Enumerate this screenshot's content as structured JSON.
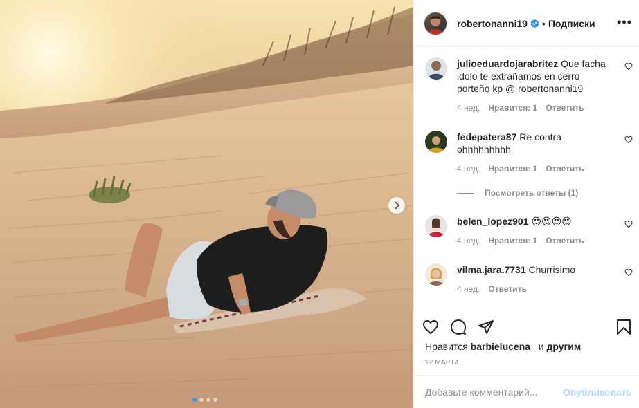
{
  "header": {
    "username": "robertonanni19",
    "bullet": "•",
    "follow_label": "Подписки",
    "more_label": "•••"
  },
  "comments": [
    {
      "username": "julioeduardojarabritez",
      "text": "Que facha idolo te extrañamos en cerro porteño kp @ robertonanni19",
      "time": "4 нед.",
      "likes": "Нравится: 1",
      "reply": "Ответить"
    },
    {
      "username": "fedepatera87",
      "text": "Re contra ohhhhhhhhh",
      "time": "4 нед.",
      "likes": "Нравится: 1",
      "reply": "Ответить"
    },
    {
      "username": "belen_lopez901",
      "text": "😍😍😍😍",
      "time": "4 нед.",
      "likes": "Нравится: 1",
      "reply": "Ответить"
    },
    {
      "username": "vilma.jara.7731",
      "text": "Churrisimo",
      "time": "4 нед.",
      "reply": "Ответить"
    }
  ],
  "view_replies": "Посмотреть ответы (1)",
  "likes_line": {
    "prefix": "Нравится",
    "user": "barbielucena_",
    "middle": "и",
    "suffix": "другим"
  },
  "date": "12 марта",
  "add_comment": {
    "placeholder": "Добавьте комментарий...",
    "post_label": "Опубликовать"
  },
  "carousel": {
    "slides": 4,
    "active_index": 0
  },
  "colors": {
    "accent": "#3897f0",
    "verified": "#3897f0",
    "post_disabled": "#b3dbff",
    "meta": "#8e8e8e"
  },
  "icons": [
    "more-icon",
    "verified-icon",
    "heart-icon",
    "comment-icon",
    "share-icon",
    "bookmark-icon",
    "chevron-right-icon"
  ]
}
